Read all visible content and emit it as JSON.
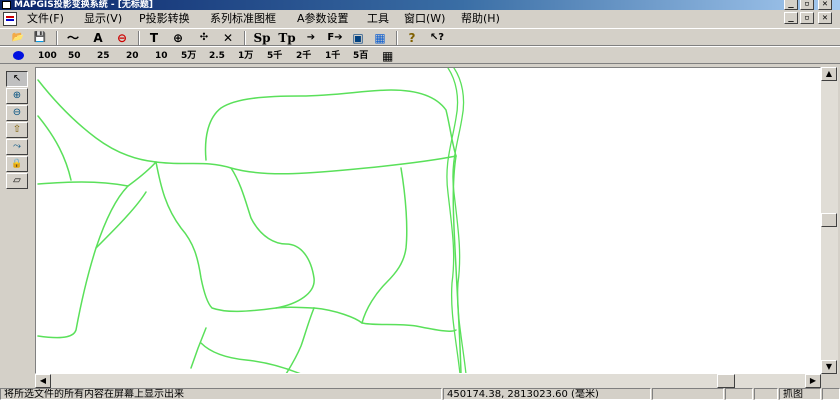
{
  "window": {
    "title": "MAPGIS投影变换系统 - [无标题]",
    "controls": {
      "minimize": "_",
      "restore": "▫",
      "close": "✕"
    }
  },
  "menubar": {
    "items": [
      {
        "id": "file",
        "label": "文件(F)"
      },
      {
        "id": "display",
        "label": "显示(V)"
      },
      {
        "id": "projection",
        "label": "P投影转换"
      },
      {
        "id": "standard-map",
        "label": "系列标准图框"
      },
      {
        "id": "params",
        "label": "A参数设置"
      },
      {
        "id": "tools",
        "label": "工具"
      },
      {
        "id": "window",
        "label": "窗口(W)"
      },
      {
        "id": "help",
        "label": "帮助(H)"
      }
    ]
  },
  "toolbar1": {
    "tools": [
      {
        "id": "open",
        "label": "📂"
      },
      {
        "id": "save",
        "label": "💾"
      },
      {
        "id": "line",
        "label": "〜"
      },
      {
        "id": "text",
        "label": "A"
      },
      {
        "id": "erase",
        "label": "⊖"
      },
      {
        "id": "text-t",
        "label": "T"
      },
      {
        "id": "point",
        "label": "⊕"
      },
      {
        "id": "pan",
        "label": "✣"
      },
      {
        "id": "cross",
        "label": "✕"
      },
      {
        "id": "sp",
        "label": "Sp"
      },
      {
        "id": "tp",
        "label": "Tp"
      },
      {
        "id": "arrow",
        "label": "➔"
      },
      {
        "id": "f-arrow",
        "label": "F➔"
      },
      {
        "id": "frame",
        "label": "▣"
      },
      {
        "id": "grid",
        "label": "▦"
      },
      {
        "id": "help-q",
        "label": "?"
      },
      {
        "id": "context-help",
        "label": "↖?"
      }
    ]
  },
  "toolbar2": {
    "dot_color": "#0010e0",
    "scales": [
      "100",
      "50",
      "25",
      "20",
      "10",
      "5万",
      "2.5",
      "1万",
      "5千",
      "2千",
      "1千",
      "5百"
    ],
    "grid_icon": "▦"
  },
  "left_tools": [
    {
      "id": "select",
      "label": "↖"
    },
    {
      "id": "zoom-in",
      "label": "⊕"
    },
    {
      "id": "zoom-out",
      "label": "⊖"
    },
    {
      "id": "up",
      "label": "⇧"
    },
    {
      "id": "move",
      "label": "⤳"
    },
    {
      "id": "lock",
      "label": "🔒"
    },
    {
      "id": "eraser",
      "label": "▱"
    }
  ],
  "map": {
    "line_color": "#5ae05a"
  },
  "statusbar": {
    "message": "将所选文件的所有内容在屏幕上显示出来",
    "coords": "450174.38, 2813023.60 (毫米)",
    "mode": "抓图"
  }
}
